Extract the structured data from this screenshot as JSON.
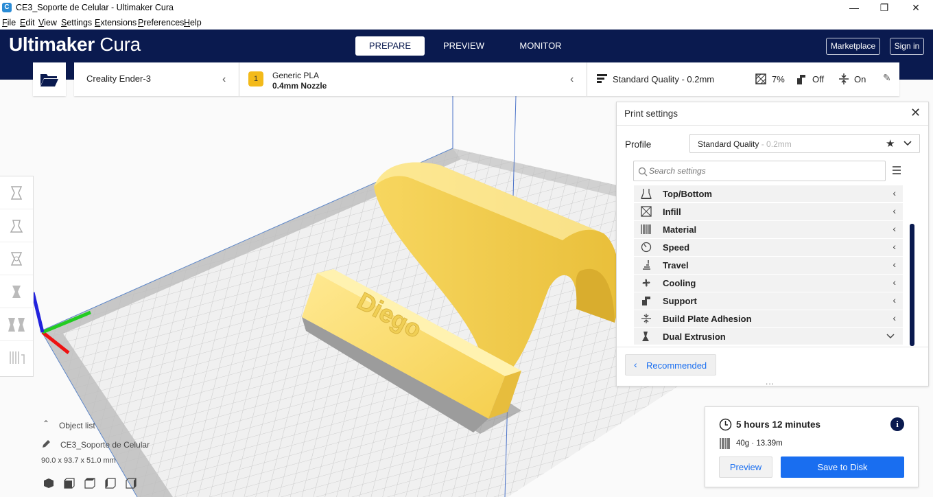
{
  "window": {
    "title": "CE3_Soporte de Celular - Ultimaker Cura",
    "app_icon": "C"
  },
  "menu": [
    "File",
    "Edit",
    "View",
    "Settings",
    "Extensions",
    "Preferences",
    "Help"
  ],
  "header": {
    "logo_bold": "Ultimaker",
    "logo_light": " Cura",
    "tabs": [
      "PREPARE",
      "PREVIEW",
      "MONITOR"
    ],
    "active_tab": "PREPARE",
    "marketplace": "Marketplace",
    "signin": "Sign in"
  },
  "machine": {
    "printer": "Creality Ender-3"
  },
  "material": {
    "badge": "1",
    "name": "Generic PLA",
    "nozzle": "0.4mm Nozzle"
  },
  "quality": {
    "profile": "Standard Quality - 0.2mm",
    "infill": "7%",
    "support": "Off",
    "adhesion": "On"
  },
  "print_settings": {
    "title": "Print settings",
    "profile_label": "Profile",
    "profile_name": "Standard Quality",
    "profile_suffix": " - 0.2mm",
    "search_placeholder": "Search settings",
    "categories": [
      {
        "label": "Top/Bottom",
        "icon": "top-bottom-icon",
        "expanded": false
      },
      {
        "label": "Infill",
        "icon": "infill-icon",
        "expanded": false
      },
      {
        "label": "Material",
        "icon": "material-icon",
        "expanded": false
      },
      {
        "label": "Speed",
        "icon": "speed-icon",
        "expanded": false
      },
      {
        "label": "Travel",
        "icon": "travel-icon",
        "expanded": false
      },
      {
        "label": "Cooling",
        "icon": "cooling-icon",
        "expanded": false
      },
      {
        "label": "Support",
        "icon": "support-icon",
        "expanded": false
      },
      {
        "label": "Build Plate Adhesion",
        "icon": "adhesion-icon",
        "expanded": false
      },
      {
        "label": "Dual Extrusion",
        "icon": "dual-extrusion-icon",
        "expanded": true
      }
    ],
    "recommended_button": "Recommended",
    "more_handle": "..."
  },
  "object_list": {
    "header": "Object list",
    "object_name": "CE3_Soporte de Celular",
    "dimensions": "90.0 x 93.7 x 51.0 mm"
  },
  "model": {
    "engraved_text": "Diego"
  },
  "job": {
    "time": "5 hours 12 minutes",
    "material_usage": "40g · 13.39m",
    "preview_button": "Preview",
    "save_button": "Save to Disk"
  },
  "colors": {
    "header_bg": "#0a1a4f",
    "accent": "#196ef0",
    "model_yellow": "#ffe26a",
    "badge_yellow": "#f3ba1a"
  }
}
